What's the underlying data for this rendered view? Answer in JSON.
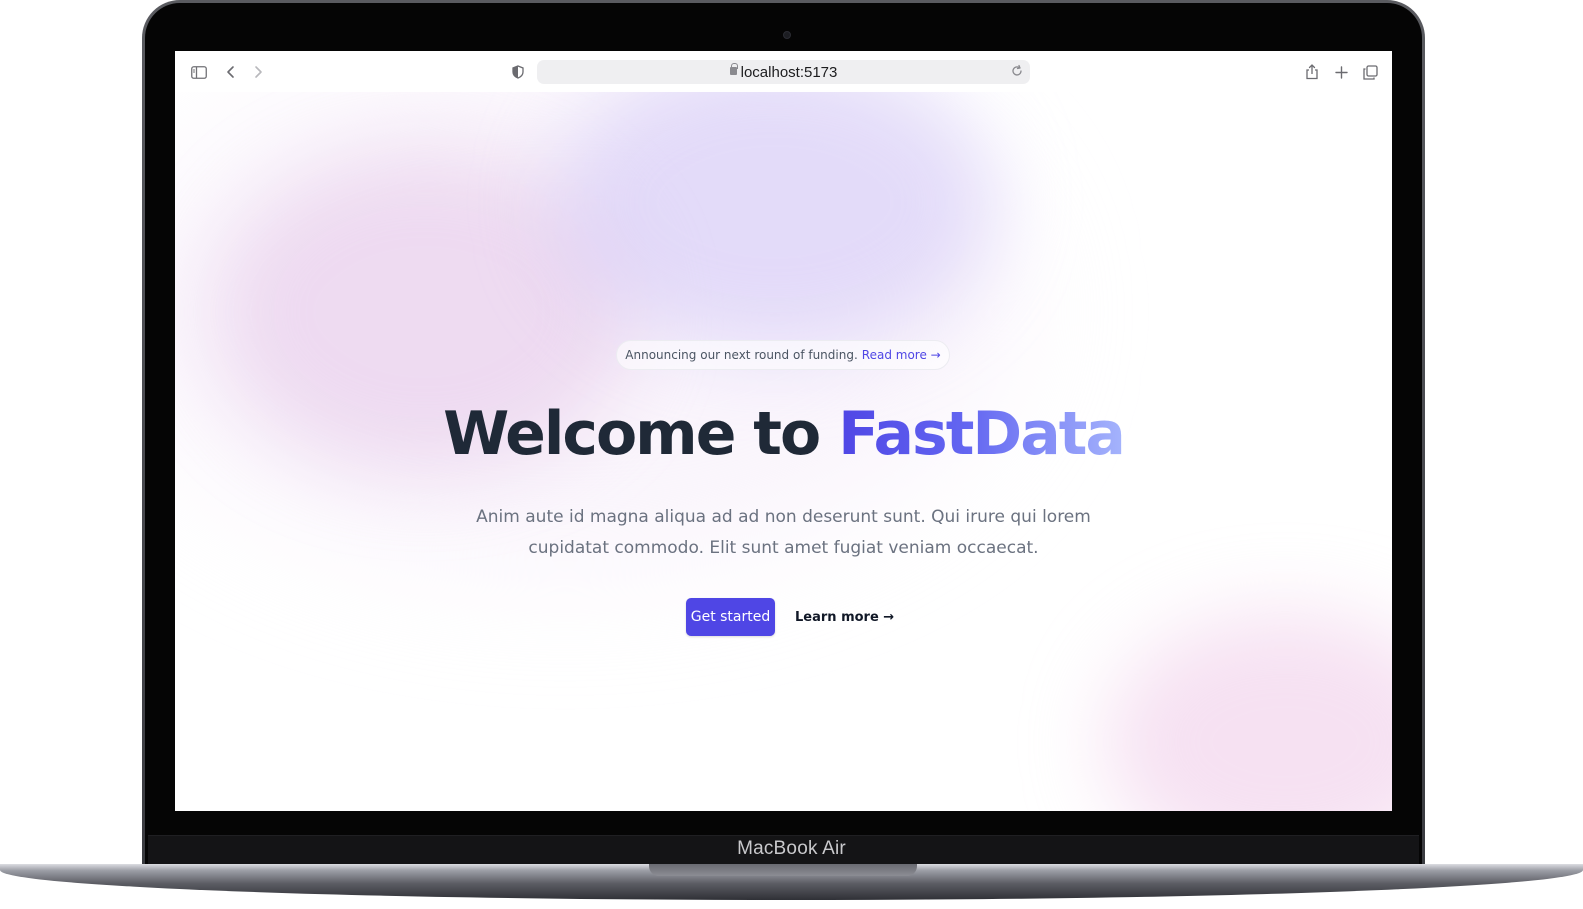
{
  "browser": {
    "url": "localhost:5173",
    "icons": {
      "sidebar": "sidebar-toggle-icon",
      "back": "chevron-left-icon",
      "forward": "chevron-right-icon",
      "privacy": "shield-icon",
      "reload": "reload-icon",
      "share": "share-icon",
      "new_tab": "plus-icon",
      "tabs": "tab-overview-icon"
    }
  },
  "hero": {
    "announcement": {
      "text": "Announcing our next round of funding.",
      "link": "Read more →"
    },
    "title": {
      "prefix": "Welcome to ",
      "accent": "FastData"
    },
    "lead_line1": "Anim aute id magna aliqua ad ad non deserunt sunt. Qui irure qui lorem",
    "lead_line2": "cupidatat commodo. Elit sunt amet fugiat veniam occaecat.",
    "primary_cta": "Get started",
    "secondary_cta": "Learn more →"
  },
  "device": {
    "label": "MacBook Air"
  },
  "colors": {
    "accent": "#4f46e5",
    "accent_light": "#a5b4fc",
    "heading": "#1f2937",
    "body_text": "#6b7280"
  }
}
